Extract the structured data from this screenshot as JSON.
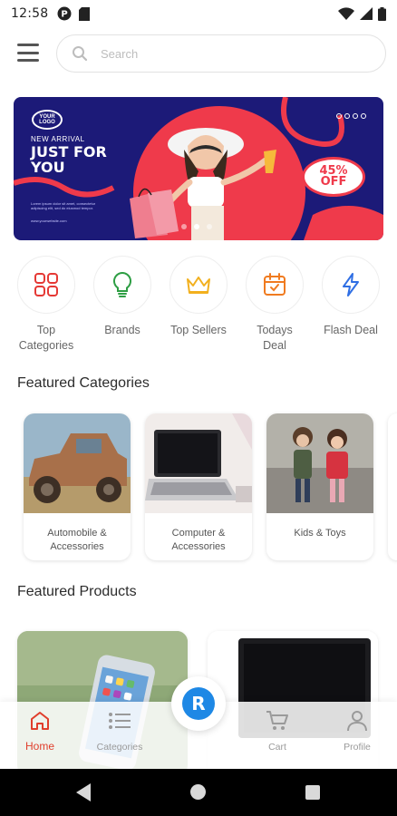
{
  "status_bar": {
    "time": "12:58"
  },
  "search": {
    "placeholder": "Search"
  },
  "banner": {
    "logo_text": "YOUR LOGO",
    "tag": "NEW ARRIVAL",
    "headline": "JUST FOR YOU",
    "small_text": "Lorem ipsum dolor sit amet, consectetur adipiscing elit, sed do eiusmod tempor.",
    "website": "www.yourwebsite.com",
    "discount_value": "45%",
    "discount_word": "OFF",
    "colors": {
      "background": "#1c1a78",
      "accent": "#ef3a4b"
    }
  },
  "quick_links": [
    {
      "label": "Top Categories",
      "icon": "grid-icon"
    },
    {
      "label": "Brands",
      "icon": "lightbulb-icon"
    },
    {
      "label": "Top Sellers",
      "icon": "crown-icon"
    },
    {
      "label": "Todays Deal",
      "icon": "calendar-icon"
    },
    {
      "label": "Flash Deal",
      "icon": "lightning-icon"
    }
  ],
  "featured_categories": {
    "title": "Featured Categories",
    "items": [
      {
        "label": "Automobile & Accessories"
      },
      {
        "label": "Computer & Accessories"
      },
      {
        "label": "Kids & Toys"
      }
    ]
  },
  "featured_products": {
    "title": "Featured Products"
  },
  "bottom_nav": {
    "items": [
      {
        "label": "Home",
        "icon": "home-icon",
        "active": true
      },
      {
        "label": "Categories",
        "icon": "list-icon"
      },
      {
        "label": "Cart",
        "icon": "cart-icon"
      },
      {
        "label": "Profile",
        "icon": "profile-icon"
      }
    ],
    "accent": "#e03e2c"
  }
}
